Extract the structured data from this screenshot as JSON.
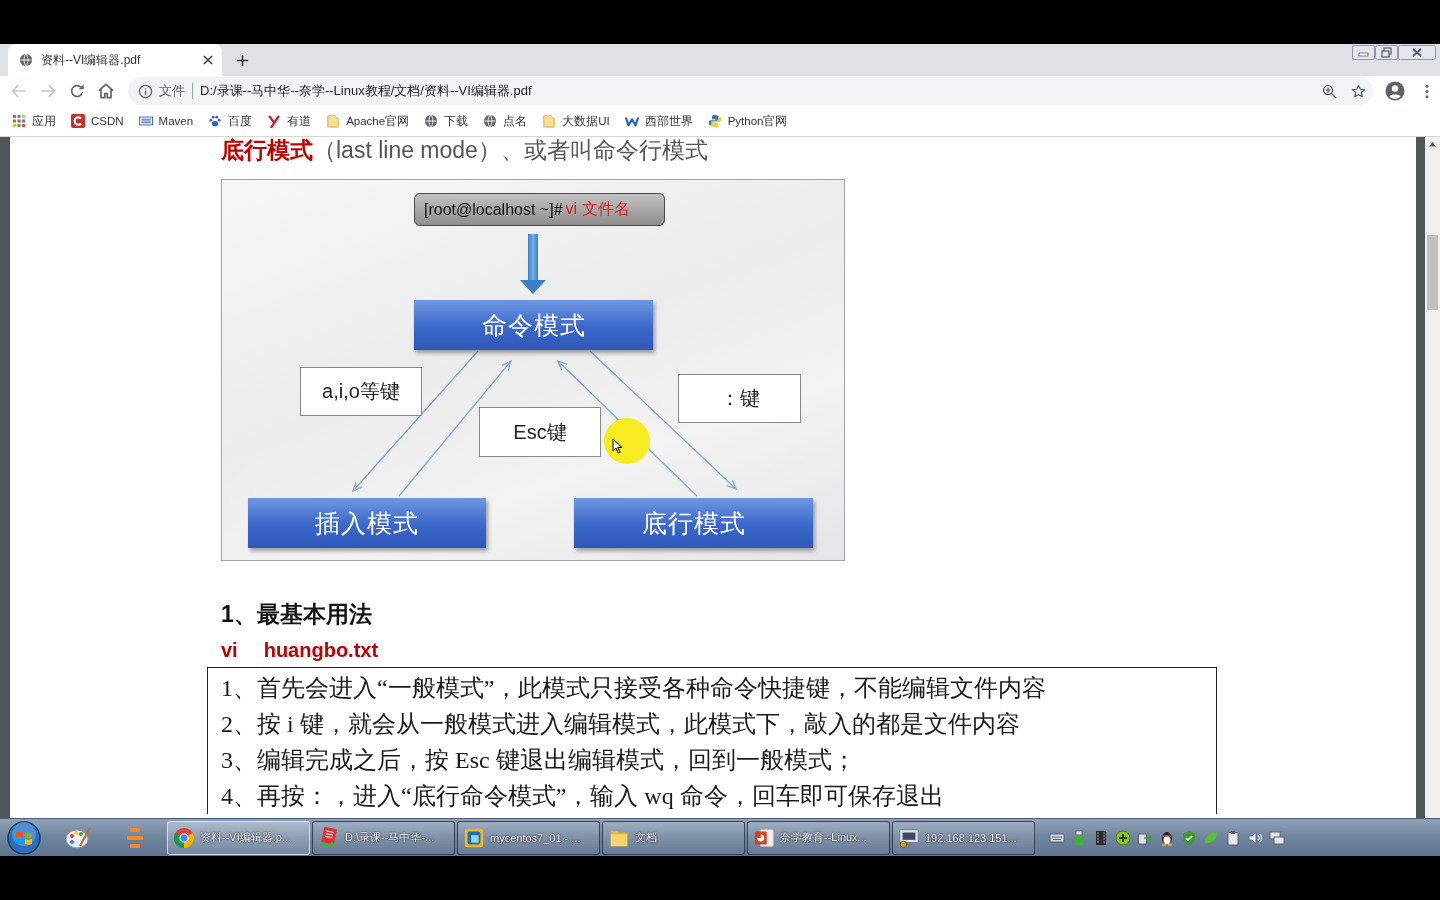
{
  "tabs": [
    {
      "title": "资料--VI编辑器.pdf",
      "selected": true
    }
  ],
  "toolbar": {
    "nav_buttons": [
      {
        "disabled": true
      },
      {
        "disabled": true
      },
      {
        "disabled": false
      },
      {
        "disabled": false
      }
    ],
    "security_label": "文件",
    "url": "D:/录课--马中华--奈学--Linux教程/文档/资料--VI编辑器.pdf"
  },
  "bookmarks": [
    {
      "label": "应用"
    },
    {
      "label": "CSDN"
    },
    {
      "label": "Maven"
    },
    {
      "label": "百度"
    },
    {
      "label": "有道"
    },
    {
      "label": "Apache官网"
    },
    {
      "label": "下载"
    },
    {
      "label": "点名"
    },
    {
      "label": "大数据UI"
    },
    {
      "label": "西部世界"
    },
    {
      "label": "Python官网"
    }
  ],
  "document": {
    "heading": "**底行模式**（last line mode）、或者叫命令行模式",
    "diagram": {
      "prompt": {
        "text": "[root@localhost ~]#",
        "command": "vi 文件名"
      },
      "modes": [
        {
          "label": "命令模式"
        },
        {
          "label": "插入模式"
        },
        {
          "label": "底行模式"
        }
      ],
      "key_labels": [
        {
          "label": "a,i,o等键"
        },
        {
          "label": "Esc键"
        },
        {
          "label": "：键"
        }
      ]
    },
    "section_title": "1、最基本用法",
    "command": {
      "program": "vi",
      "argument": "huangbo.txt"
    },
    "steps": [
      "1、首先会进入“一般模式”，此模式只接受各种命令快捷键，不能编辑文件内容",
      "2、按 i 键，就会从一般模式进入编辑模式，此模式下，敲入的都是文件内容",
      "3、编辑完成之后，按 Esc 键退出编辑模式，回到一般模式；",
      "4、再按：，进入“底行命令模式”，输入 wq 命令，回车即可保存退出"
    ]
  },
  "taskbar": {
    "tasks": [
      {
        "label": "资料--VI编辑器.p...",
        "selected": true
      },
      {
        "label": "D:\\录课--马中华-...",
        "selected": false
      },
      {
        "label": "mycentos7_01 - ...",
        "selected": false
      },
      {
        "label": "文档",
        "selected": false
      },
      {
        "label": "奈学教育--Linux...",
        "selected": false
      },
      {
        "label": "192.168.123.151...",
        "selected": false
      }
    ]
  }
}
